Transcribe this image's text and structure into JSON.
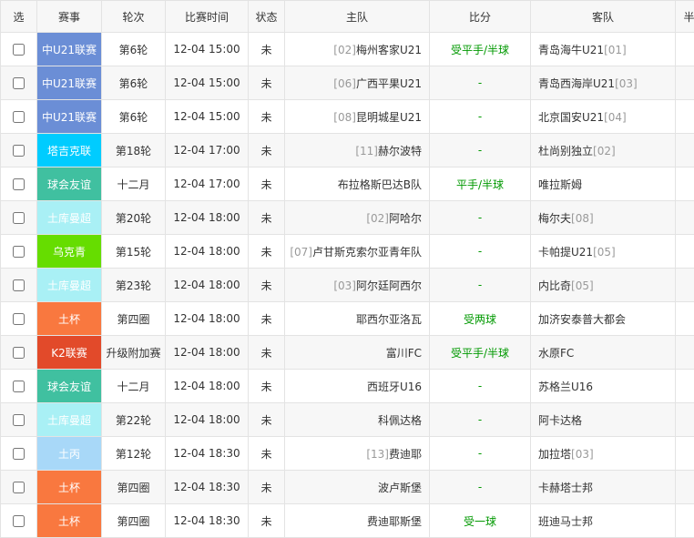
{
  "headers": {
    "select": "选",
    "league": "赛事",
    "round": "轮次",
    "time": "比赛时间",
    "status": "状态",
    "home": "主队",
    "score": "比分",
    "away": "客队",
    "extra": "半"
  },
  "matches": [
    {
      "league": "中U21联赛",
      "league_color": "#6b8ed6",
      "round": "第6轮",
      "time": "12-04 15:00",
      "status": "未",
      "home_rank": "[02]",
      "home": "梅州客家U21",
      "score": "受平手/半球",
      "away": "青岛海牛U21",
      "away_rank": "[01]"
    },
    {
      "league": "中U21联赛",
      "league_color": "#6b8ed6",
      "round": "第6轮",
      "time": "12-04 15:00",
      "status": "未",
      "home_rank": "[06]",
      "home": "广西平果U21",
      "score": "-",
      "away": "青岛西海岸U21",
      "away_rank": "[03]"
    },
    {
      "league": "中U21联赛",
      "league_color": "#6b8ed6",
      "round": "第6轮",
      "time": "12-04 15:00",
      "status": "未",
      "home_rank": "[08]",
      "home": "昆明城星U21",
      "score": "-",
      "away": "北京国安U21",
      "away_rank": "[04]"
    },
    {
      "league": "塔吉克联",
      "league_color": "#00ccff",
      "round": "第18轮",
      "time": "12-04 17:00",
      "status": "未",
      "home_rank": "[11]",
      "home": "赫尔波特",
      "score": "-",
      "away": "杜尚别独立",
      "away_rank": "[02]"
    },
    {
      "league": "球会友谊",
      "league_color": "#40c0a0",
      "round": "十二月",
      "time": "12-04 17:00",
      "status": "未",
      "home_rank": "",
      "home": "布拉格斯巴达B队",
      "score": "平手/半球",
      "away": "唯拉斯姆",
      "away_rank": ""
    },
    {
      "league": "土库曼超",
      "league_color": "#a9f0f5",
      "round": "第20轮",
      "time": "12-04 18:00",
      "status": "未",
      "home_rank": "[02]",
      "home": "阿哈尔",
      "score": "-",
      "away": "梅尔夫",
      "away_rank": "[08]"
    },
    {
      "league": "乌克青",
      "league_color": "#66dd00",
      "round": "第15轮",
      "time": "12-04 18:00",
      "status": "未",
      "home_rank": "[07]",
      "home": "卢甘斯克索尔亚青年队",
      "score": "-",
      "away": "卡帕提U21",
      "away_rank": "[05]"
    },
    {
      "league": "土库曼超",
      "league_color": "#a9f0f5",
      "round": "第23轮",
      "time": "12-04 18:00",
      "status": "未",
      "home_rank": "[03]",
      "home": "阿尔廷阿西尔",
      "score": "-",
      "away": "内比奇",
      "away_rank": "[05]"
    },
    {
      "league": "土杯",
      "league_color": "#f9783f",
      "round": "第四圈",
      "time": "12-04 18:00",
      "status": "未",
      "home_rank": "",
      "home": "耶西尔亚洛瓦",
      "score": "受两球",
      "away": "加济安泰普大都会",
      "away_rank": ""
    },
    {
      "league": "K2联赛",
      "league_color": "#e24a2a",
      "round": "升级附加赛",
      "time": "12-04 18:00",
      "status": "未",
      "home_rank": "",
      "home": "富川FC",
      "score": "受平手/半球",
      "away": "水原FC",
      "away_rank": ""
    },
    {
      "league": "球会友谊",
      "league_color": "#40c0a0",
      "round": "十二月",
      "time": "12-04 18:00",
      "status": "未",
      "home_rank": "",
      "home": "西班牙U16",
      "score": "-",
      "away": "苏格兰U16",
      "away_rank": ""
    },
    {
      "league": "土库曼超",
      "league_color": "#a9f0f5",
      "round": "第22轮",
      "time": "12-04 18:00",
      "status": "未",
      "home_rank": "",
      "home": "科佩达格",
      "score": "-",
      "away": "阿卡达格",
      "away_rank": ""
    },
    {
      "league": "土丙",
      "league_color": "#a8d8f8",
      "round": "第12轮",
      "time": "12-04 18:30",
      "status": "未",
      "home_rank": "[13]",
      "home": "费迪耶",
      "score": "-",
      "away": "加拉塔",
      "away_rank": "[03]"
    },
    {
      "league": "土杯",
      "league_color": "#f9783f",
      "round": "第四圈",
      "time": "12-04 18:30",
      "status": "未",
      "home_rank": "",
      "home": "波卢斯堡",
      "score": "-",
      "away": "卡赫塔士邦",
      "away_rank": ""
    },
    {
      "league": "土杯",
      "league_color": "#f9783f",
      "round": "第四圈",
      "time": "12-04 18:30",
      "status": "未",
      "home_rank": "",
      "home": "费迪耶斯堡",
      "score": "受一球",
      "away": "班迪马士邦",
      "away_rank": ""
    }
  ]
}
